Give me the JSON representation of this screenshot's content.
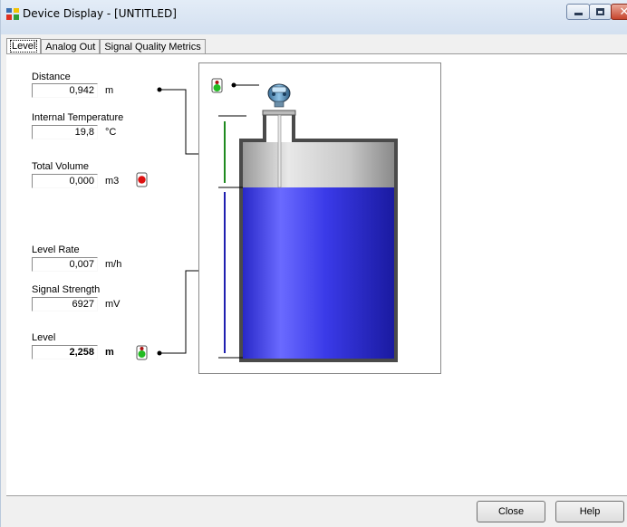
{
  "window": {
    "title": "Device Display - [UNTITLED]",
    "minimize_icon": "minimize-icon",
    "maximize_icon": "maximize-icon",
    "close_icon": "close-icon"
  },
  "tabs": [
    {
      "label": "Level",
      "active": true
    },
    {
      "label": "Analog Out",
      "active": false
    },
    {
      "label": "Signal Quality Metrics",
      "active": false
    }
  ],
  "fields": {
    "distance": {
      "label": "Distance",
      "value": "0,942",
      "unit": "m"
    },
    "internal_temperature": {
      "label": "Internal Temperature",
      "value": "19,8",
      "unit": "°C"
    },
    "total_volume": {
      "label": "Total Volume",
      "value": "0,000",
      "unit": "m3",
      "status": "red"
    },
    "level_rate": {
      "label": "Level Rate",
      "value": "0,007",
      "unit": "m/h"
    },
    "signal_strength": {
      "label": "Signal Strength",
      "value": "6927",
      "unit": "mV"
    },
    "level": {
      "label": "Level",
      "value": "2,258",
      "unit": "m",
      "status": "green"
    }
  },
  "diagram": {
    "fill_fraction": 0.71,
    "device_status": "green",
    "colors": {
      "liquid": "#3a3ae8",
      "empty_space": "#c8c8c8",
      "distance_bar": "#1f8a1f",
      "level_bar": "#1f1fb0"
    }
  },
  "footer": {
    "close_label": "Close",
    "help_label": "Help"
  }
}
